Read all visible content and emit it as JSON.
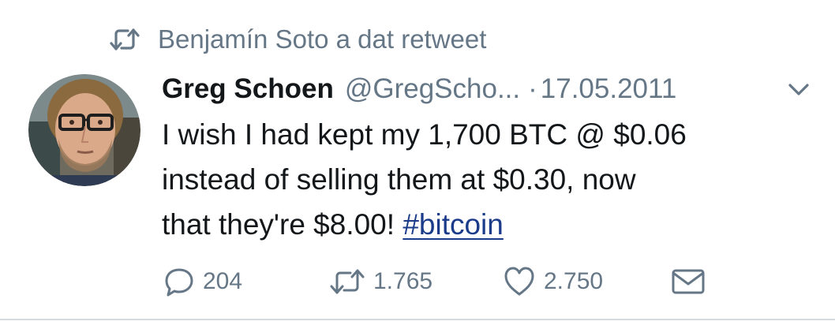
{
  "retweet_context": {
    "icon": "retweet-icon",
    "text": "Benjamín Soto a dat retweet"
  },
  "author": {
    "avatar": "avatar",
    "name": "Greg Schoen",
    "handle": "@GregScho...",
    "separator": "·",
    "date": "17.05.2011"
  },
  "tweet": {
    "line1": "I wish I had kept my 1,700 BTC @ $0.06",
    "line2": "instead of selling them at $0.30, now",
    "line3_prefix": "that they're $8.00! ",
    "hashtag": "#bitcoin"
  },
  "actions": {
    "reply_count": "204",
    "retweet_count": "1.765",
    "like_count": "2.750"
  },
  "colors": {
    "text": "#14171a",
    "secondary": "#657786",
    "hashtag": "#1a3a8a",
    "divider": "#d6dbe0"
  }
}
